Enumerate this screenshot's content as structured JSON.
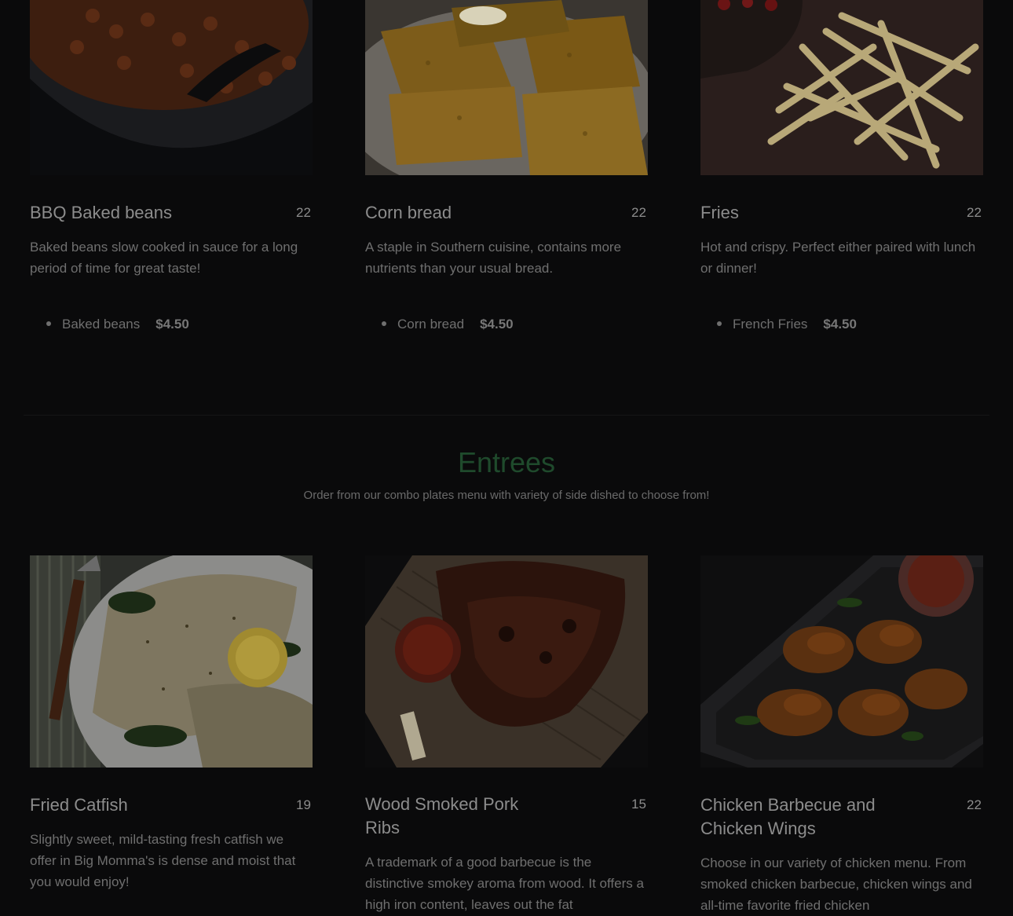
{
  "sides": [
    {
      "name": "BBQ Baked beans",
      "num": "22",
      "desc": "Baked beans slow cooked in sauce for a long period of time for great taste!",
      "item": "Baked beans",
      "price": "$4.50"
    },
    {
      "name": "Corn bread",
      "num": "22",
      "desc": "A staple in Southern cuisine,  contains more nutrients than your usual bread.",
      "item": "Corn bread",
      "price": "$4.50"
    },
    {
      "name": "Fries",
      "num": "22",
      "desc": "Hot and crispy. Perfect either paired with lunch or dinner!",
      "item": "French Fries",
      "price": "$4.50"
    }
  ],
  "entrees_section": {
    "title": "Entrees",
    "subtitle": "Order from our combo plates menu with variety of side dished to choose from!"
  },
  "entrees": [
    {
      "name": "Fried Catfish",
      "num": "19",
      "desc": "Slightly sweet, mild-tasting fresh catfish we offer in Big Momma's is dense and moist that you would enjoy!"
    },
    {
      "name": "Wood Smoked Pork Ribs",
      "num": "15",
      "desc": "A trademark of a good barbecue is the distinctive smokey aroma from wood.  It offers a high iron content, leaves out the fat"
    },
    {
      "name": "Chicken Barbecue and Chicken Wings",
      "num": "22",
      "desc": "Choose in our variety of chicken menu. From smoked chicken barbecue, chicken wings and all-time favorite fried chicken"
    }
  ]
}
